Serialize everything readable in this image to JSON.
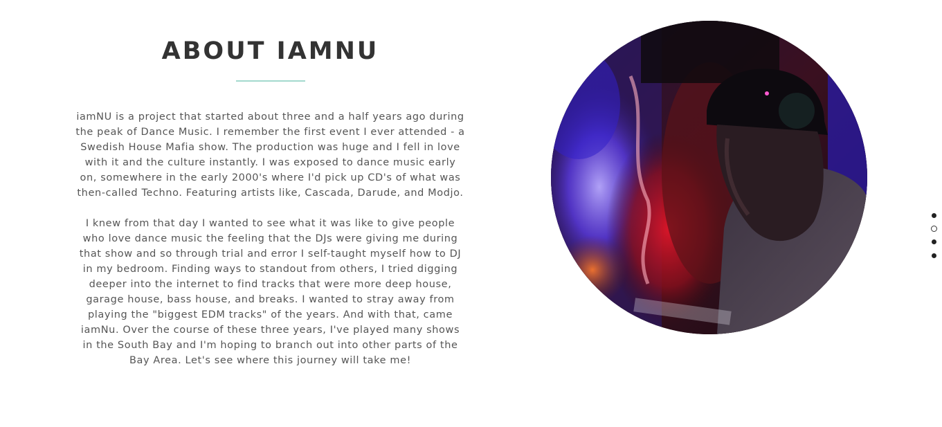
{
  "about": {
    "title": "ABOUT IAMNU",
    "paragraph_1": "iamNU is a project that started about three and a half years ago during the peak of Dance Music. I remember the first event I ever attended - a Swedish House Mafia show. The production was huge and I fell in love with it and the culture instantly. I was exposed to dance music early on, somewhere in the early 2000's where I'd pick up CD's of what was then-called Techno. Featuring artists like, Cascada, Darude, and Modjo.",
    "paragraph_2": "I knew from that day I wanted to see what it was like to give people who love dance music the feeling that the DJs were giving me during that show and so through trial and error I self-taught myself how to DJ in my bedroom. Finding ways to standout from others, I tried digging deeper into the internet to find tracks that were more deep house, garage house, bass house, and breaks. I wanted to stray away from playing the \"biggest EDM tracks\" of the years. And with that, came iamNu. Over the course of these three years, I've played many shows in the South Bay and I'm hoping to branch out into other parts of the Bay Area. Let's see where this journey will take me!"
  },
  "colors": {
    "title": "#333333",
    "body_text": "#555555",
    "divider": "#a3d9cd",
    "dot": "#222222"
  },
  "dot_nav": {
    "count": 4,
    "active_index": 1
  }
}
